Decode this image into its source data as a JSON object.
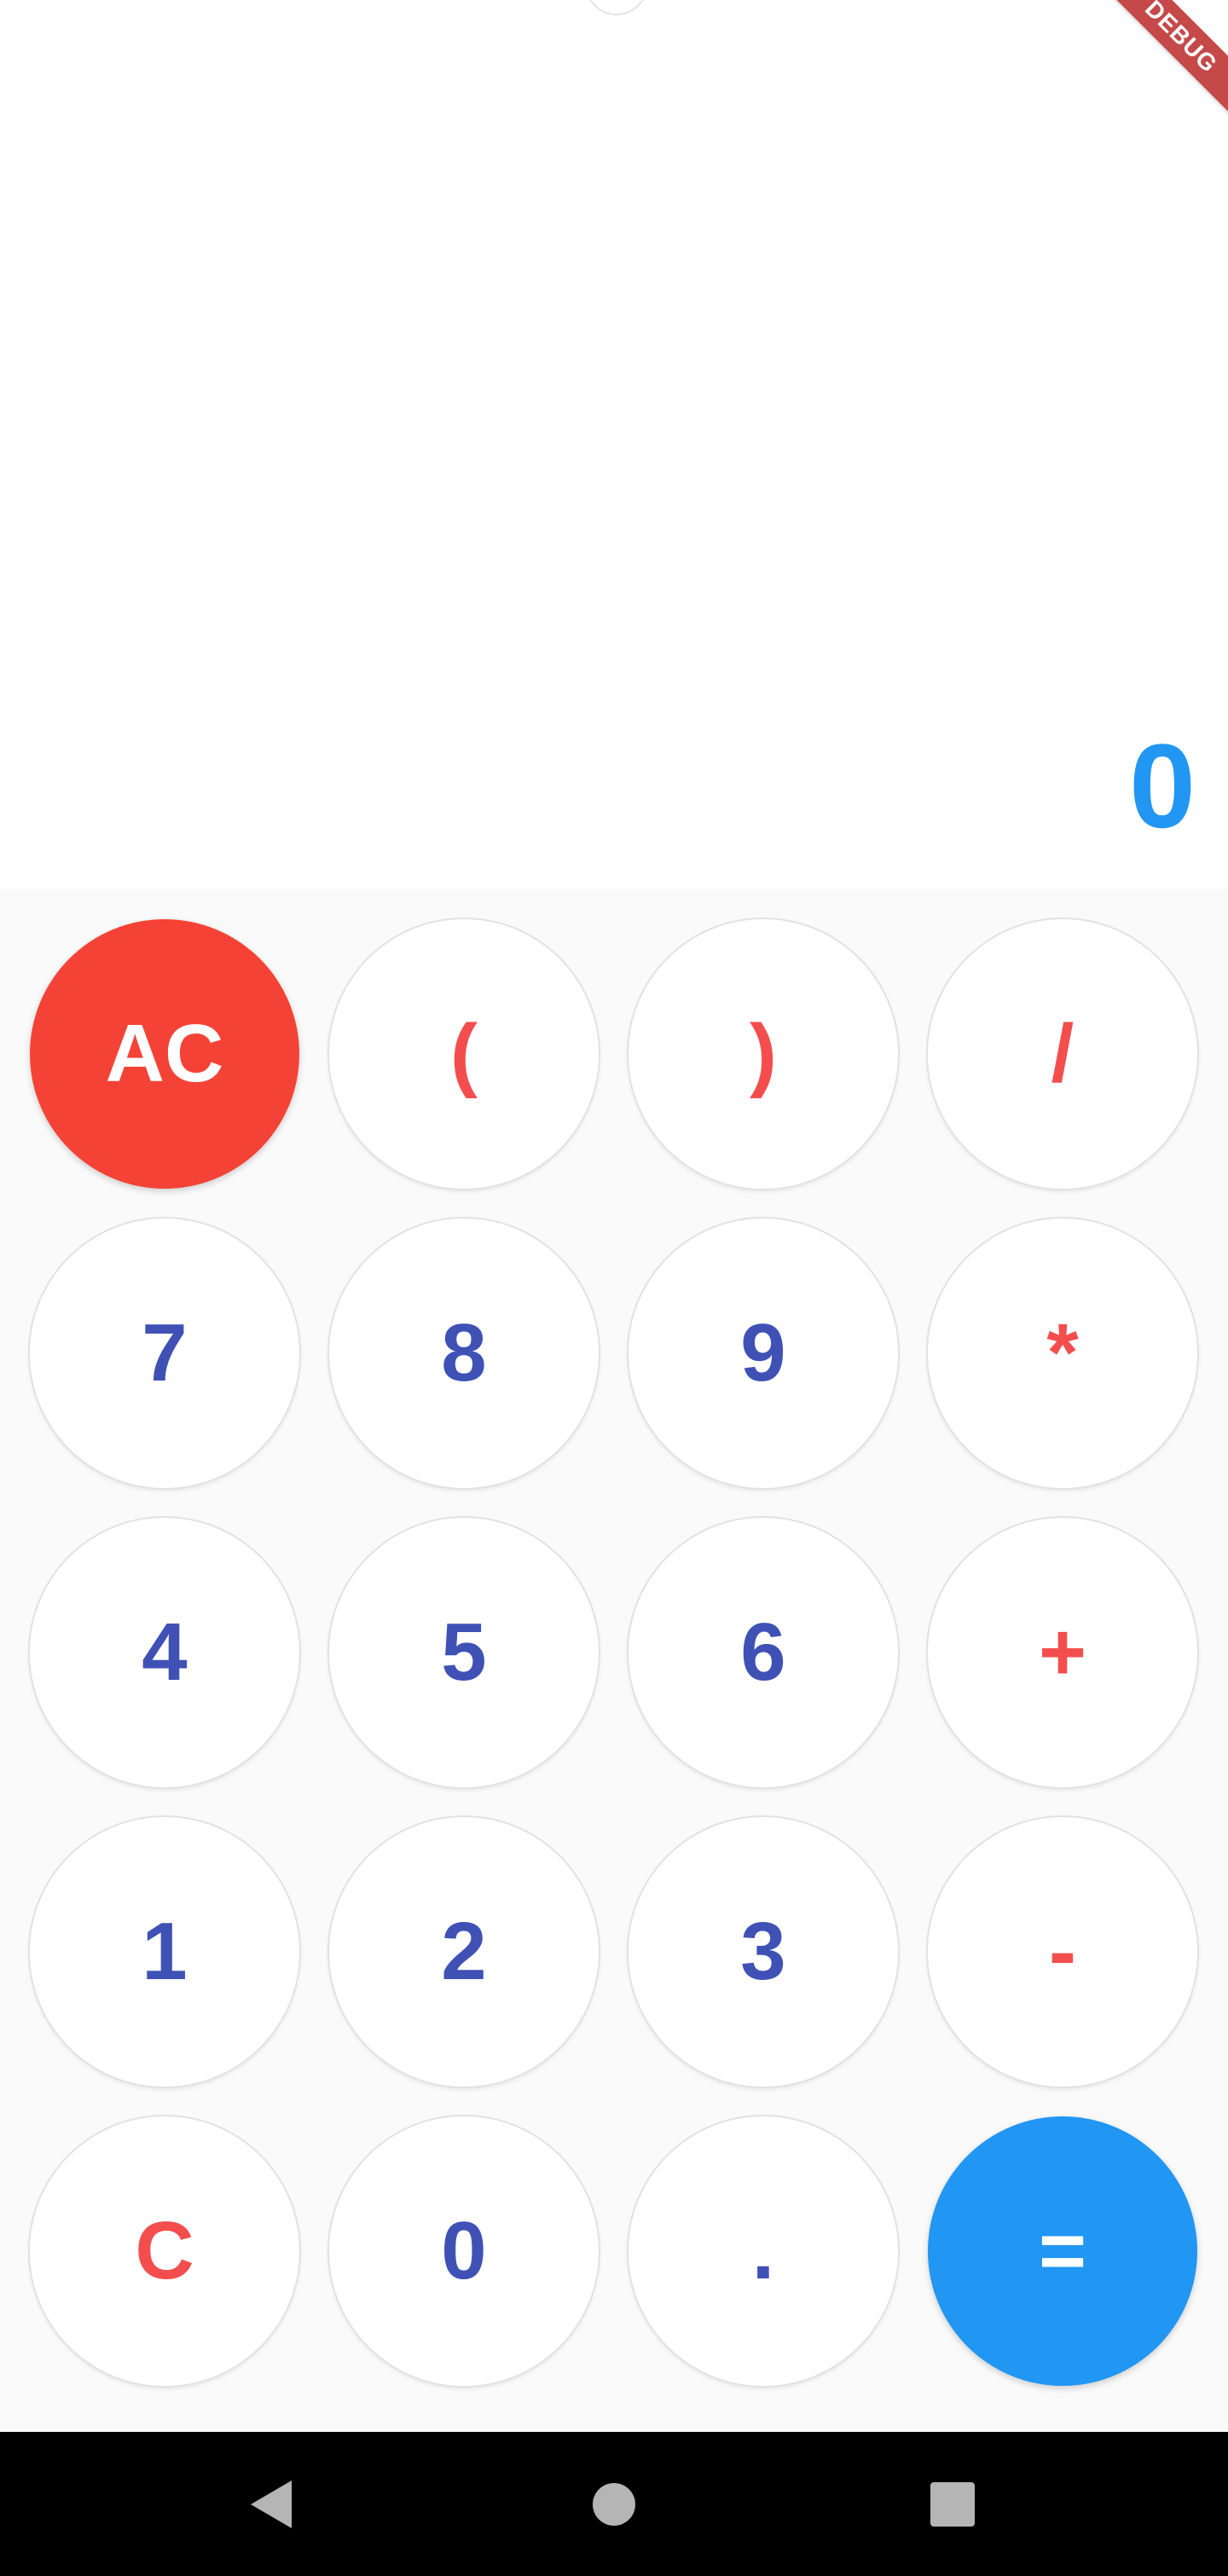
{
  "app": {
    "debug_banner": "DEBUG"
  },
  "display": {
    "expression": "",
    "result": "0"
  },
  "colors": {
    "digit": "#3F51B5",
    "operator": "#F44D4D",
    "clear_all_bg": "#F44336",
    "equals_bg": "#2196F3",
    "result_text": "#2196F3",
    "keypad_bg": "#fafafa"
  },
  "keypad": {
    "rows": [
      [
        "AC",
        "(",
        ")",
        "/"
      ],
      [
        "7",
        "8",
        "9",
        "*"
      ],
      [
        "4",
        "5",
        "6",
        "+"
      ],
      [
        "1",
        "2",
        "3",
        "-"
      ],
      [
        "C",
        "0",
        ".",
        "="
      ]
    ]
  },
  "navbar": {
    "back_icon": "back-triangle-icon",
    "home_icon": "home-circle-icon",
    "recents_icon": "recents-square-icon"
  }
}
